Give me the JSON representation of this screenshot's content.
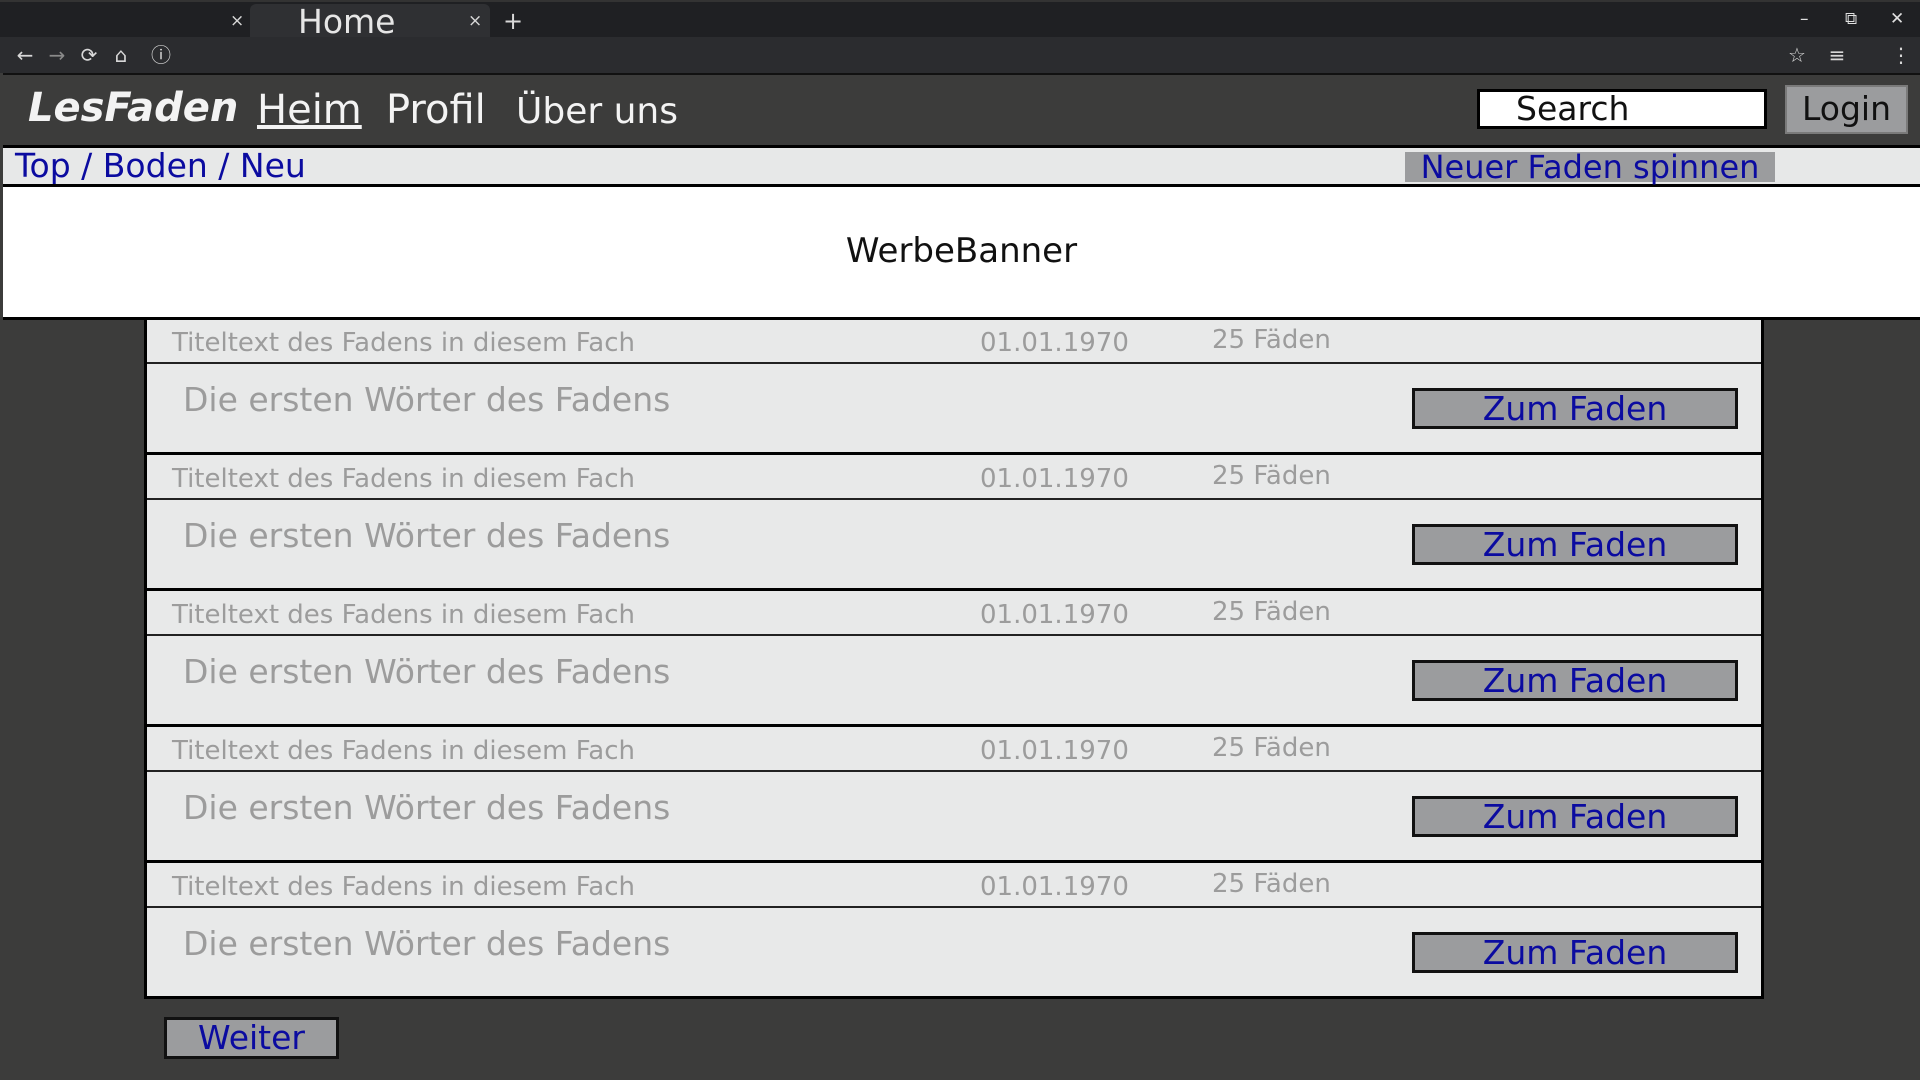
{
  "browser": {
    "tabs": [
      {
        "title": "",
        "close": "×"
      },
      {
        "title": "Home",
        "close": "×"
      }
    ],
    "new_tab": "+",
    "window_controls": {
      "minimize": "–",
      "restore": "⧉",
      "close": "✕"
    },
    "toolbar": {
      "back": "←",
      "forward": "→",
      "reload": "⟳",
      "home": "⌂",
      "info": "ⓘ",
      "bookmark": "☆",
      "media": "≡",
      "menu": "⋮"
    }
  },
  "nav": {
    "logo": "LesFaden",
    "links": [
      "Heim",
      "Profil",
      "Über uns"
    ],
    "search_placeholder": "Search",
    "login": "Login"
  },
  "subbar": {
    "crumbs": [
      "Top",
      "Boden",
      "Neu"
    ],
    "separator": " / ",
    "new_thread": "Neuer Faden spinnen"
  },
  "banner": "WerbeBanner",
  "threads": [
    {
      "title": "Titeltext des Fadens in diesem Fach",
      "date": "01.01.1970",
      "count": "25 Fäden",
      "excerpt": "Die ersten Wörter des Fadens",
      "button": "Zum Faden"
    },
    {
      "title": "Titeltext des Fadens in diesem Fach",
      "date": "01.01.1970",
      "count": "25 Fäden",
      "excerpt": "Die ersten Wörter des Fadens",
      "button": "Zum Faden"
    },
    {
      "title": "Titeltext des Fadens in diesem Fach",
      "date": "01.01.1970",
      "count": "25 Fäden",
      "excerpt": "Die ersten Wörter des Fadens",
      "button": "Zum Faden"
    },
    {
      "title": "Titeltext des Fadens in diesem Fach",
      "date": "01.01.1970",
      "count": "25 Fäden",
      "excerpt": "Die ersten Wörter des Fadens",
      "button": "Zum Faden"
    },
    {
      "title": "Titeltext des Fadens in diesem Fach",
      "date": "01.01.1970",
      "count": "25 Fäden",
      "excerpt": "Die ersten Wörter des Fadens",
      "button": "Zum Faden"
    }
  ],
  "pagination": {
    "next": "Weiter"
  }
}
